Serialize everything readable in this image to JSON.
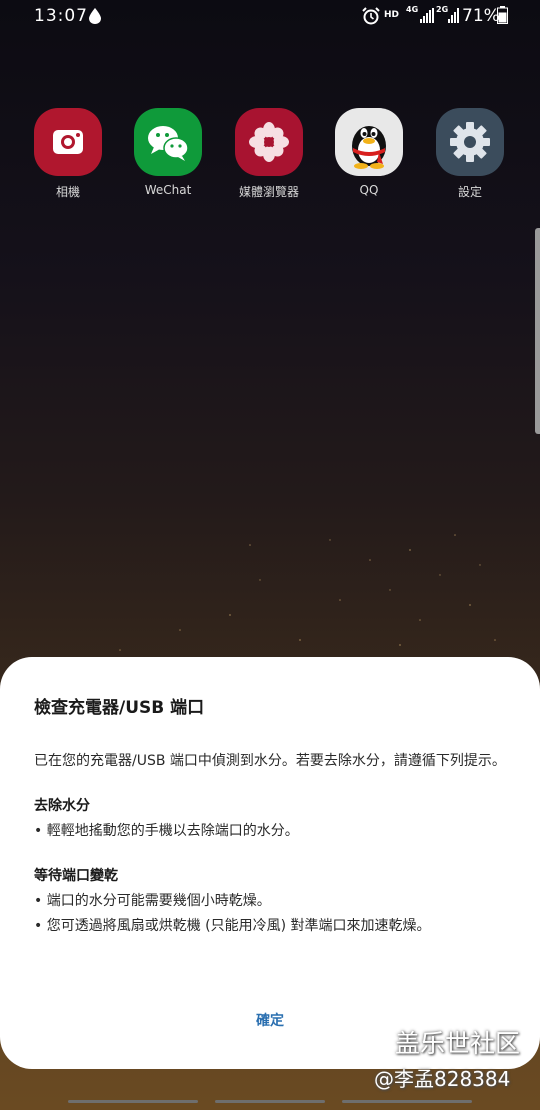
{
  "status": {
    "time": "13:07",
    "hd": "HD",
    "net1": "4G",
    "net2": "2G",
    "battery": "71%"
  },
  "apps": [
    {
      "label": "相機",
      "icon": "camera-icon",
      "color": "#b0172e"
    },
    {
      "label": "WeChat",
      "icon": "wechat-icon",
      "color": "#0f9a3a"
    },
    {
      "label": "媒體瀏覽器",
      "icon": "flower-icon",
      "color": "#a81330"
    },
    {
      "label": "QQ",
      "icon": "qq-penguin-icon",
      "color": "#e8e8e8"
    },
    {
      "label": "設定",
      "icon": "gear-icon",
      "color": "#3b4c5c"
    }
  ],
  "dialog": {
    "title": "檢查充電器/USB 端口",
    "intro": "已在您的充電器/USB 端口中偵測到水分。若要去除水分，請遵循下列提示。",
    "section1": {
      "heading": "去除水分",
      "bullets": [
        "• 輕輕地搖動您的手機以去除端口的水分。"
      ]
    },
    "section2": {
      "heading": "等待端口變乾",
      "bullets": [
        "• 端口的水分可能需要幾個小時乾燥。",
        "• 您可透過將風扇或烘乾機 (只能用冷風) 對準端口來加速乾燥。"
      ]
    },
    "confirm": "確定"
  },
  "watermark": {
    "line1": "盖乐世社区",
    "line2": "@李孟828384"
  }
}
